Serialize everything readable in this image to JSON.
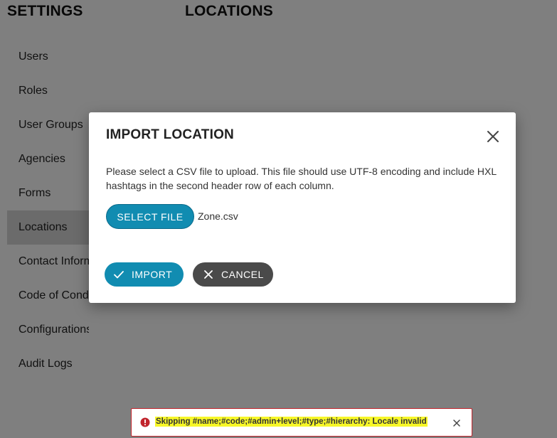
{
  "settings": {
    "heading": "SETTINGS",
    "items": [
      {
        "label": "Users"
      },
      {
        "label": "Roles"
      },
      {
        "label": "User Groups"
      },
      {
        "label": "Agencies"
      },
      {
        "label": "Forms"
      },
      {
        "label": "Locations",
        "active": true
      },
      {
        "label": "Contact Information"
      },
      {
        "label": "Code of Conduct"
      },
      {
        "label": "Configurations"
      },
      {
        "label": "Audit Logs"
      }
    ]
  },
  "page": {
    "title": "LOCATIONS"
  },
  "dialog": {
    "title": "IMPORT LOCATION",
    "close_icon": "close-icon",
    "instructions": "Please select a CSV file to upload. This file should use UTF-8 encoding and include HXL hashtags in the second header row of each column.",
    "select_file_label": "SELECT FILE",
    "file_name": "Zone.csv",
    "import_label": "IMPORT",
    "import_icon": "check-icon",
    "cancel_label": "CANCEL",
    "cancel_icon": "close-icon"
  },
  "toast": {
    "icon": "error-icon",
    "message": "Skipping #name;#code;#admin+level;#type;#hierarchy: Locale invalid",
    "close_icon": "close-icon"
  },
  "colors": {
    "primary": "#118cb1",
    "secondary": "#4a4a4a",
    "error": "#c0242c",
    "highlight": "#f7f727"
  }
}
